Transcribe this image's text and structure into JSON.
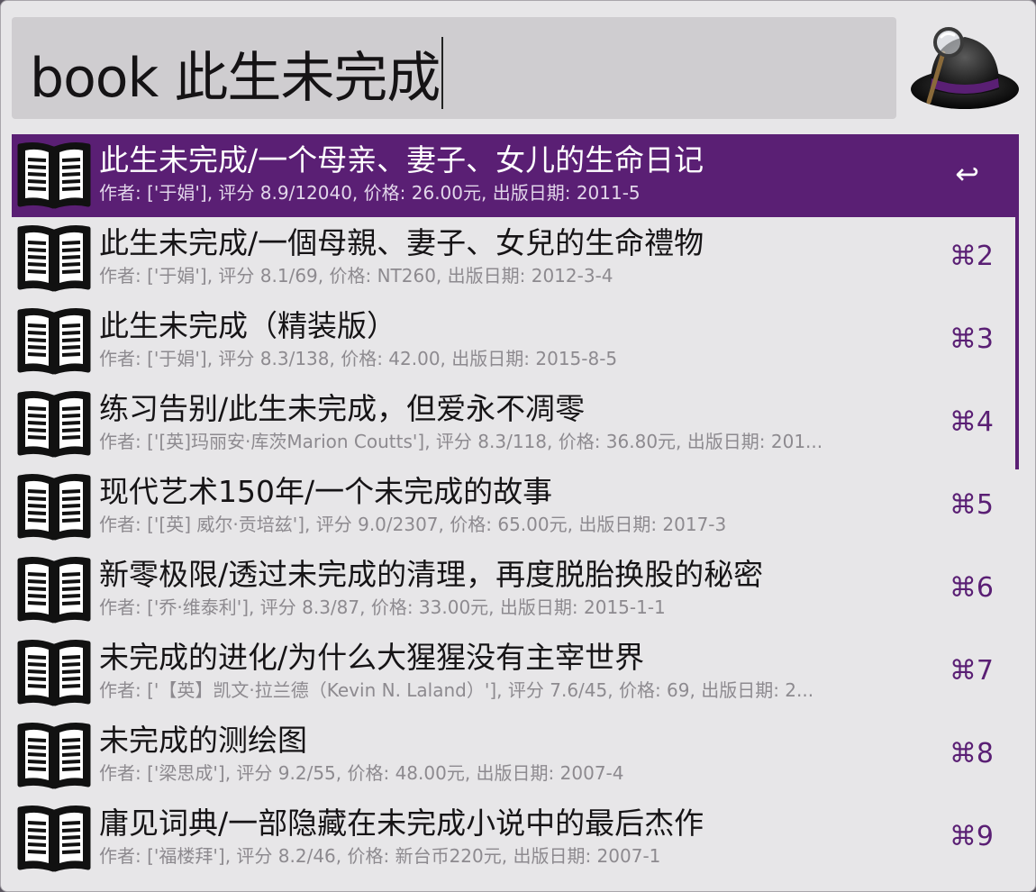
{
  "search": {
    "query": "book 此生未完成"
  },
  "app": {
    "logo": "alfred-hat-icon"
  },
  "colors": {
    "accent": "#5a1f74",
    "background": "#e7e6e8",
    "search_field": "#cfcdd0"
  },
  "results": [
    {
      "title": "此生未完成/一个母亲、妻子、女儿的生命日记",
      "subtitle": "作者: ['于娟'], 评分 8.9/12040, 价格: 26.00元, 出版日期: 2011-5",
      "shortcut": "↩",
      "selected": true,
      "icon": "book-icon"
    },
    {
      "title": "此生未完成/一個母親、妻子、女兒的生命禮物",
      "subtitle": "作者: ['于娟'], 评分 8.1/69, 价格: NT260, 出版日期: 2012-3-4",
      "shortcut": "⌘2",
      "icon": "book-icon"
    },
    {
      "title": "此生未完成（精装版）",
      "subtitle": "作者: ['于娟'], 评分 8.3/138, 价格: 42.00, 出版日期: 2015-8-5",
      "shortcut": "⌘3",
      "icon": "book-icon"
    },
    {
      "title": "练习告别/此生未完成，但爱永不凋零",
      "subtitle": "作者: ['[英]玛丽安·库茨Marion Coutts'], 评分 8.3/118, 价格: 36.80元, 出版日期: 201...",
      "shortcut": "⌘4",
      "icon": "book-icon"
    },
    {
      "title": "现代艺术150年/一个未完成的故事",
      "subtitle": "作者: ['[英] 威尔·贡培兹'], 评分 9.0/2307, 价格: 65.00元, 出版日期: 2017-3",
      "shortcut": "⌘5",
      "icon": "book-icon"
    },
    {
      "title": "新零极限/透过未完成的清理，再度脱胎换股的秘密",
      "subtitle": "作者: ['乔·维泰利'], 评分 8.3/87, 价格: 33.00元, 出版日期: 2015-1-1",
      "shortcut": "⌘6",
      "icon": "book-icon"
    },
    {
      "title": "未完成的进化/为什么大猩猩没有主宰世界",
      "subtitle": "作者: ['【英】凯文·拉兰德（Kevin N. Laland）'], 评分 7.6/45, 价格: 69, 出版日期: 2...",
      "shortcut": "⌘7",
      "icon": "book-icon"
    },
    {
      "title": "未完成的测绘图",
      "subtitle": "作者: ['梁思成'], 评分 9.2/55, 价格: 48.00元, 出版日期: 2007-4",
      "shortcut": "⌘8",
      "icon": "book-icon"
    },
    {
      "title": "庸见词典/一部隐藏在未完成小说中的最后杰作",
      "subtitle": "作者: ['福楼拜'], 评分 8.2/46, 价格: 新台币220元, 出版日期: 2007-1",
      "shortcut": "⌘9",
      "icon": "book-icon"
    }
  ]
}
